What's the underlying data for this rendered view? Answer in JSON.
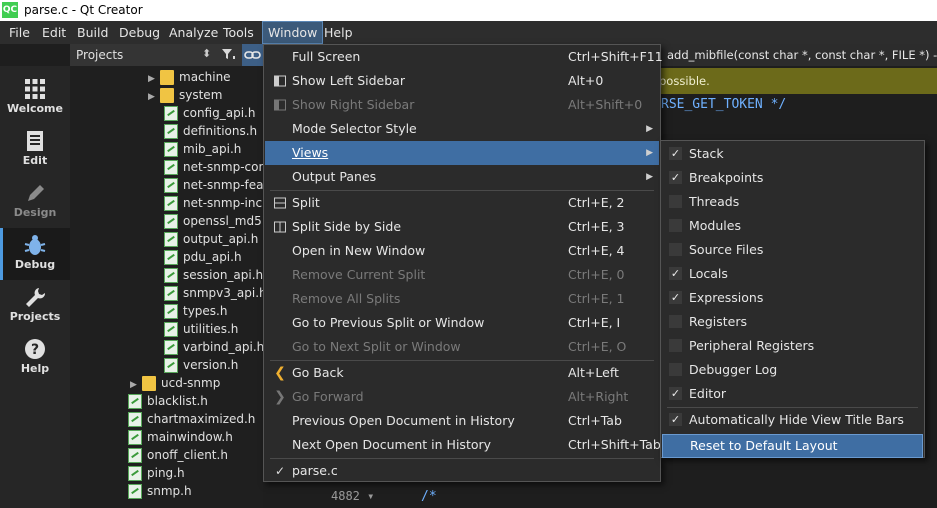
{
  "window": {
    "title": "parse.c - Qt Creator",
    "logo": "QC"
  },
  "menubar": [
    "File",
    "Edit",
    "Build",
    "Debug",
    "Analyze",
    "Tools",
    "Window",
    "Help"
  ],
  "modes": [
    {
      "label": "Welcome",
      "icon": "grid-icon"
    },
    {
      "label": "Edit",
      "icon": "document-icon"
    },
    {
      "label": "Design",
      "icon": "pencil-icon"
    },
    {
      "label": "Debug",
      "icon": "bug-icon"
    },
    {
      "label": "Projects",
      "icon": "wrench-icon"
    },
    {
      "label": "Help",
      "icon": "question-icon"
    }
  ],
  "projects": {
    "header": "Projects",
    "tree": [
      {
        "label": "machine",
        "type": "folder",
        "expandable": true
      },
      {
        "label": "system",
        "type": "folder",
        "expandable": true
      },
      {
        "label": "config_api.h",
        "type": "file"
      },
      {
        "label": "definitions.h",
        "type": "file"
      },
      {
        "label": "mib_api.h",
        "type": "file"
      },
      {
        "label": "net-snmp-con",
        "type": "file"
      },
      {
        "label": "net-snmp-feat",
        "type": "file"
      },
      {
        "label": "net-snmp-inclu",
        "type": "file"
      },
      {
        "label": "openssl_md5.h",
        "type": "file"
      },
      {
        "label": "output_api.h",
        "type": "file"
      },
      {
        "label": "pdu_api.h",
        "type": "file"
      },
      {
        "label": "session_api.h",
        "type": "file"
      },
      {
        "label": "snmpv3_api.h",
        "type": "file"
      },
      {
        "label": "types.h",
        "type": "file"
      },
      {
        "label": "utilities.h",
        "type": "file"
      },
      {
        "label": "varbind_api.h",
        "type": "file"
      },
      {
        "label": "version.h",
        "type": "file"
      },
      {
        "label": "ucd-snmp",
        "type": "folder",
        "expandable": true
      },
      {
        "label": "blacklist.h",
        "type": "file"
      },
      {
        "label": "chartmaximized.h",
        "type": "file"
      },
      {
        "label": "mainwindow.h",
        "type": "file"
      },
      {
        "label": "onoff_client.h",
        "type": "file"
      },
      {
        "label": "ping.h",
        "type": "file"
      },
      {
        "label": "snmp.h",
        "type": "file"
      }
    ]
  },
  "editor": {
    "function_selector": "add_mibfile(const char *, const char *, FILE *) -> int",
    "warning_text": "possible.",
    "code_line_1": "RSE_GET_TOKEN */",
    "code_line_2": "/*",
    "line_number": "4882"
  },
  "window_menu": [
    {
      "label": "Full Screen",
      "shortcut": "Ctrl+Shift+F11"
    },
    {
      "label": "Show Left Sidebar",
      "shortcut": "Alt+0",
      "mark": "sidebar-icon"
    },
    {
      "label": "Show Right Sidebar",
      "shortcut": "Alt+Shift+0",
      "disabled": true,
      "mark": "sidebar-icon"
    },
    {
      "label": "Mode Selector Style",
      "submenu": true
    },
    {
      "label": "Views",
      "submenu": true,
      "highlighted": true
    },
    {
      "label": "Output Panes",
      "submenu": true
    },
    {
      "label": "Split",
      "shortcut": "Ctrl+E, 2",
      "mark": "split-icon"
    },
    {
      "label": "Split Side by Side",
      "shortcut": "Ctrl+E, 3",
      "mark": "split-side-icon"
    },
    {
      "label": "Open in New Window",
      "shortcut": "Ctrl+E, 4"
    },
    {
      "label": "Remove Current Split",
      "shortcut": "Ctrl+E, 0",
      "disabled": true
    },
    {
      "label": "Remove All Splits",
      "shortcut": "Ctrl+E, 1",
      "disabled": true
    },
    {
      "label": "Go to Previous Split or Window",
      "shortcut": "Ctrl+E, I"
    },
    {
      "label": "Go to Next Split or Window",
      "shortcut": "Ctrl+E, O",
      "disabled": true
    },
    {
      "label": "Go Back",
      "shortcut": "Alt+Left",
      "mark": "back-arrow-icon"
    },
    {
      "label": "Go Forward",
      "shortcut": "Alt+Right",
      "disabled": true,
      "mark": "forward-arrow-icon"
    },
    {
      "label": "Previous Open Document in History",
      "shortcut": "Ctrl+Tab"
    },
    {
      "label": "Next Open Document in History",
      "shortcut": "Ctrl+Shift+Tab"
    },
    {
      "label": "parse.c",
      "checked": true
    }
  ],
  "views_menu": [
    {
      "label": "Stack",
      "checked": true
    },
    {
      "label": "Breakpoints",
      "checked": true
    },
    {
      "label": "Threads",
      "checked": false
    },
    {
      "label": "Modules",
      "checked": false
    },
    {
      "label": "Source Files",
      "checked": false
    },
    {
      "label": "Locals",
      "checked": true
    },
    {
      "label": "Expressions",
      "checked": true
    },
    {
      "label": "Registers",
      "checked": false
    },
    {
      "label": "Peripheral Registers",
      "checked": false
    },
    {
      "label": "Debugger Log",
      "checked": false
    },
    {
      "label": "Editor",
      "checked": true
    },
    {
      "label": "Automatically Hide View Title Bars",
      "checked": true
    },
    {
      "label": "Reset to Default Layout",
      "highlighted": true
    }
  ]
}
